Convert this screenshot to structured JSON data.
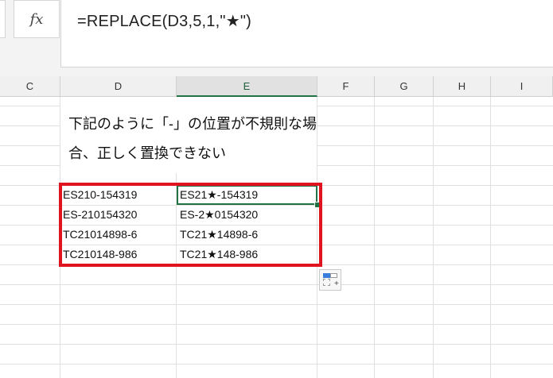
{
  "formula_bar": {
    "fx_label": "fx",
    "formula": "=REPLACE(D3,5,1,\"★\")"
  },
  "columns": [
    "C",
    "D",
    "E",
    "F",
    "G",
    "H",
    "I"
  ],
  "selected_column": "E",
  "note": {
    "line1": "下記のように「-」の位置が不規則な場",
    "line2": "合、正しく置換できない"
  },
  "table": {
    "rows": [
      {
        "d": "ES210-154319",
        "e": "ES21★-154319"
      },
      {
        "d": "ES-210154320",
        "e": "ES-2★0154320"
      },
      {
        "d": "TC21014898-6",
        "e": "TC21★14898-6"
      },
      {
        "d": "TC210148-986",
        "e": "TC21★148-986"
      }
    ]
  },
  "colors": {
    "highlight_border": "#e0141e",
    "selection": "#217346"
  },
  "icons": {
    "fx": "fx-icon",
    "quick_analysis": "quick-analysis-icon"
  }
}
